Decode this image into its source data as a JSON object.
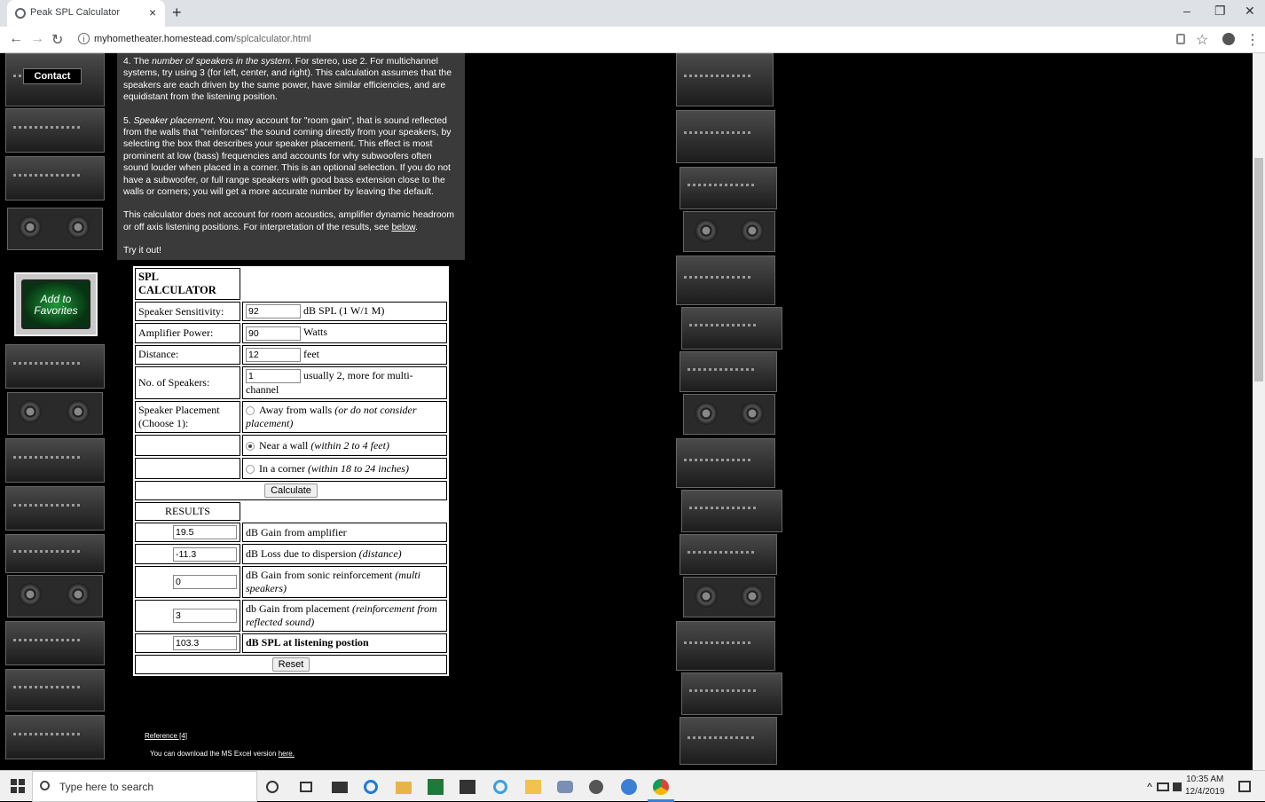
{
  "browser": {
    "tab_title": "Peak SPL Calculator",
    "tab_close": "×",
    "new_tab": "+",
    "url_host": "myhometheater.homestead.com",
    "url_path": "/splcalculator.html",
    "info_glyph": "i",
    "back": "←",
    "forward": "→",
    "reload": "↻",
    "star": "☆",
    "minimize": "–",
    "restore": "❐",
    "close": "✕",
    "menu": "⋮"
  },
  "sidebar": {
    "contact_label": "Contact",
    "favorites_line1": "Add to",
    "favorites_line2": "Favorites"
  },
  "intro": {
    "p4_num": "4.  The ",
    "p4_em": "number of speakers in the system",
    "p4_rest": ".  For stereo, use 2.  For multichannel systems, try using 3 (for left,  center, and right).  This calculation assumes that the speakers are each driven by the same power, have similar efficiencies, and are equidistant from the listening position.",
    "p5_num": "5.  ",
    "p5_em": "Speaker placement",
    "p5_rest": ".  You may account for \"room gain\", that is sound reflected from the walls that \"reinforces\" the sound coming directly from your speakers, by selecting the box that describes your speaker placement.  This effect is most prominent at low (bass) frequencies and accounts for why subwoofers often sound louder when placed in a corner.  This is an optional selection. If you do not have a subwoofer, or full range speakers with good bass extension close to the walls or corners; you will get a more accurate number by leaving the default.",
    "p6_text": "This calculator does not account for room acoustics, amplifier dynamic headroom or off axis listening positions.  For interpretation of the results, see ",
    "p6_link": "below",
    "p6_end": ".",
    "try_it": "Try it out!"
  },
  "calculator": {
    "title": "SPL CALCULATOR",
    "sensitivity_label": "Speaker Sensitivity:",
    "sensitivity_value": "92",
    "sensitivity_unit": "dB SPL (1 W/1 M)",
    "power_label": "Amplifier Power:",
    "power_value": "90",
    "power_unit": "Watts",
    "distance_label": "Distance:",
    "distance_value": "12",
    "distance_unit": "feet",
    "speakers_label": "No. of Speakers:",
    "speakers_value": "1",
    "speakers_unit": "usually 2, more for multi-channel",
    "placement_label_1": "Speaker Placement",
    "placement_label_2": "(Choose 1):",
    "opt_away": "Away from walls ",
    "opt_away_em": "(or do not consider placement)",
    "opt_wall": "Near a wall ",
    "opt_wall_em": "(within 2 to 4 feet)",
    "opt_corner": "In a corner ",
    "opt_corner_em": "(within 18 to 24 inches)",
    "calculate_label": "Calculate",
    "results_label": "RESULTS",
    "r1_value": "19.5",
    "r1_label": "dB Gain from amplifier",
    "r2_value": "-11.3",
    "r2_label": "dB Loss due to dispersion ",
    "r2_em": "(distance)",
    "r3_value": "0",
    "r3_label": "dB Gain from sonic reinforcement ",
    "r3_em": "(multi speakers)",
    "r4_value": "3",
    "r4_label": "db Gain from placement ",
    "r4_em": "(reinforcement from reflected sound)",
    "r5_value": "103.3",
    "r5_label": "dB SPL at listening postion",
    "reset_label": "Reset"
  },
  "footer": {
    "reference": "Reference [4]",
    "download_text": "You can download the MS Excel version ",
    "download_link": "here."
  },
  "taskbar": {
    "search_placeholder": "Type here to search",
    "time": "10:35 AM",
    "date": "12/4/2019"
  }
}
